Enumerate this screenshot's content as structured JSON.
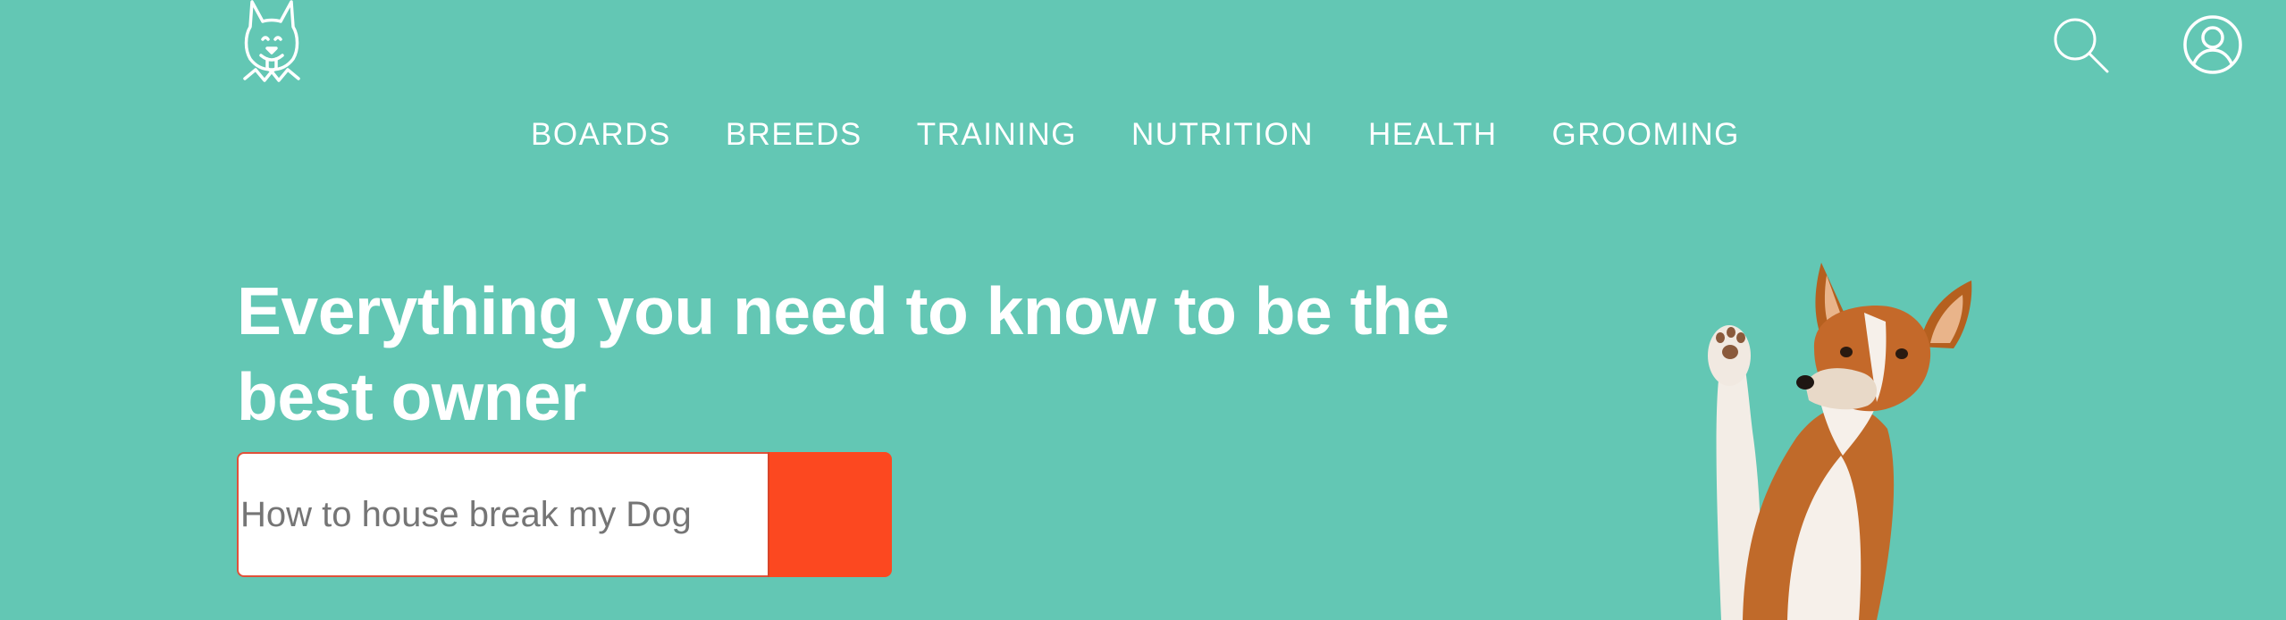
{
  "header": {
    "logo_icon": "dog-face-logo-icon",
    "search_icon": "search-icon",
    "account_icon": "user-circle-icon"
  },
  "nav": {
    "items": [
      {
        "label": "BOARDS"
      },
      {
        "label": "BREEDS"
      },
      {
        "label": "TRAINING"
      },
      {
        "label": "NUTRITION"
      },
      {
        "label": "HEALTH"
      },
      {
        "label": "GROOMING"
      }
    ]
  },
  "hero": {
    "title": "Everything you need to know to be the best owner",
    "search": {
      "placeholder": "How to house break my Dog",
      "button_label": ""
    },
    "image": "waving-dog-illustration"
  },
  "colors": {
    "background": "#63c7b4",
    "text": "#ffffff",
    "accent": "#fc4820",
    "input_border": "#e0513a",
    "placeholder": "#757575"
  }
}
